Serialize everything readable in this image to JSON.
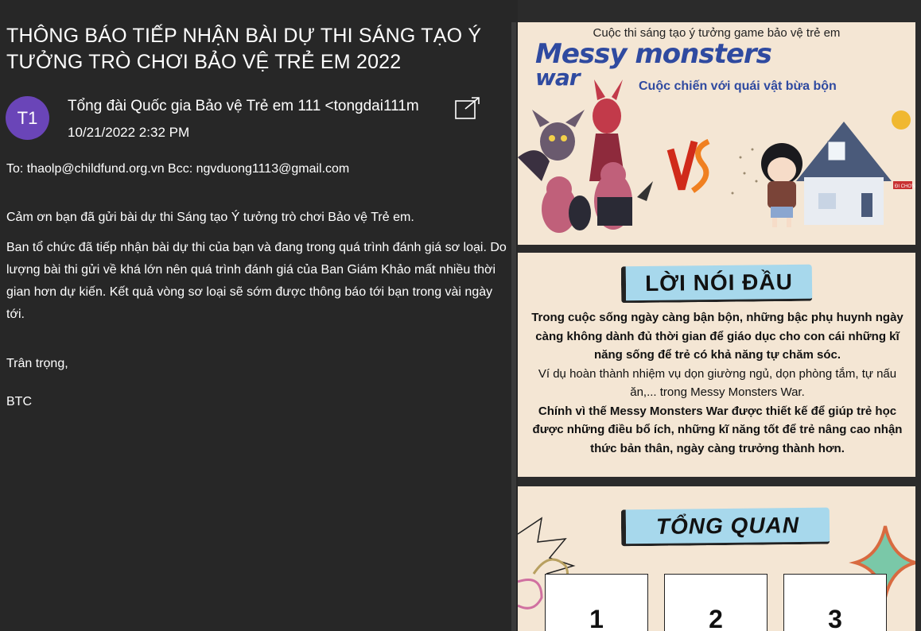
{
  "email": {
    "subject": "THÔNG BÁO TIẾP NHẬN BÀI DỰ THI SÁNG TẠO Ý TƯỞNG TRÒ CHƠI BẢO VỆ TRẺ EM 2022",
    "avatar_initials": "T1",
    "avatar_color": "#6a45b8",
    "sender": "Tổng đài Quốc gia Bảo vệ Trẻ em 111 <tongdai111m",
    "timestamp": "10/21/2022 2:32 PM",
    "recipients": "To: thaolp@childfund.org.vn Bcc: ngvduong1113@gmail.com",
    "body": [
      "Cảm ơn bạn đã gửi bài dự thi Sáng tạo Ý tưởng trò chơi Bảo vệ Trẻ em.",
      "Ban tổ chức đã tiếp nhận bài dự thi của bạn và đang trong quá trình đánh giá sơ loại. Do lượng bài thi gửi về khá lớn nên quá trình đánh giá của Ban Giám Khảo mất nhiều thời gian hơn dự kiến. Kết quả vòng sơ loại sẽ sớm được thông báo tới bạn trong vài ngày tới.",
      "Trân trọng,",
      "BTC"
    ]
  },
  "attachment": {
    "poster_tagline": "Cuộc thi sáng tạo ý tưởng game bảo vệ trẻ em",
    "game_title_line1": "Messy monsters",
    "game_title_line2": "war",
    "game_subtitle": "Cuộc chiến với quái vật bừa bộn",
    "vs_label": "VS",
    "house_sign": "ĐI CHƠNG",
    "intro_heading": "LỜI NÓI ĐẦU",
    "intro_lines": [
      "Trong cuộc sống ngày càng bận bộn, những bậc phụ huynh ngày càng không dành đủ thời gian để giáo dục cho con cái những kĩ năng sống để trẻ có khả năng tự chăm sóc.",
      "Ví dụ hoàn thành nhiệm vụ dọn giường ngủ, dọn phòng tắm, tự nấu ăn,... trong Messy Monsters War.",
      "Chính vì thế Messy Monsters War được thiết kế để giúp trẻ học được những điều bổ ích, những kĩ năng tốt để trẻ nâng cao nhận thức bản thân, ngày càng trưởng thành hơn."
    ],
    "overview_heading": "TỔNG QUAN",
    "overview_cards": [
      "1",
      "2",
      "3"
    ],
    "page_bg": "#f4e6d4",
    "accent_blue": "#2f4aa0"
  }
}
